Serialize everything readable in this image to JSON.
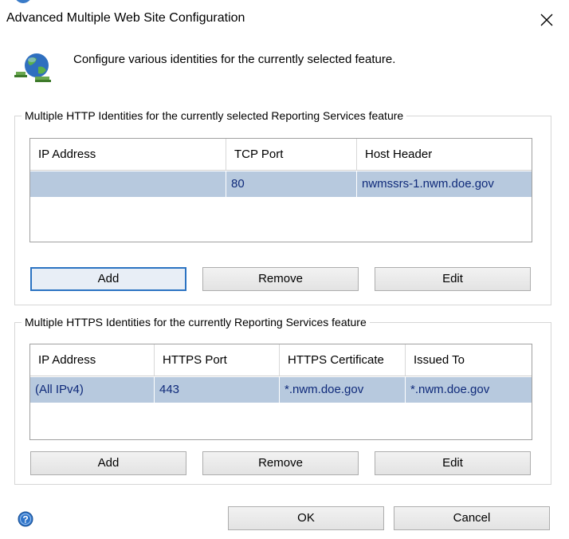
{
  "window": {
    "title": "Advanced Multiple Web Site Configuration"
  },
  "header": {
    "description": "Configure various identities for the currently selected feature."
  },
  "http_group": {
    "legend": "Multiple HTTP Identities for the currently selected Reporting Services feature",
    "columns": [
      "IP Address",
      "TCP Port",
      "Host Header"
    ],
    "rows": [
      [
        "",
        "80",
        "nwmssrs-1.nwm.doe.gov"
      ]
    ],
    "buttons": {
      "add": "Add",
      "remove": "Remove",
      "edit": "Edit"
    }
  },
  "https_group": {
    "legend": "Multiple HTTPS Identities for the currently Reporting Services feature",
    "columns": [
      "IP Address",
      "HTTPS Port",
      "HTTPS Certificate",
      "Issued To"
    ],
    "rows": [
      [
        "(All IPv4)",
        "443",
        "*.nwm.doe.gov",
        "*.nwm.doe.gov"
      ]
    ],
    "buttons": {
      "add": "Add",
      "remove": "Remove",
      "edit": "Edit"
    }
  },
  "footer": {
    "ok": "OK",
    "cancel": "Cancel"
  },
  "icons": {
    "header": "network-globe-icon",
    "close": "close-icon",
    "help": "help-icon"
  },
  "colors": {
    "selected_row": "#b7c9de",
    "row_text": "#0f2a7a",
    "focus_border": "#2b73c2"
  }
}
